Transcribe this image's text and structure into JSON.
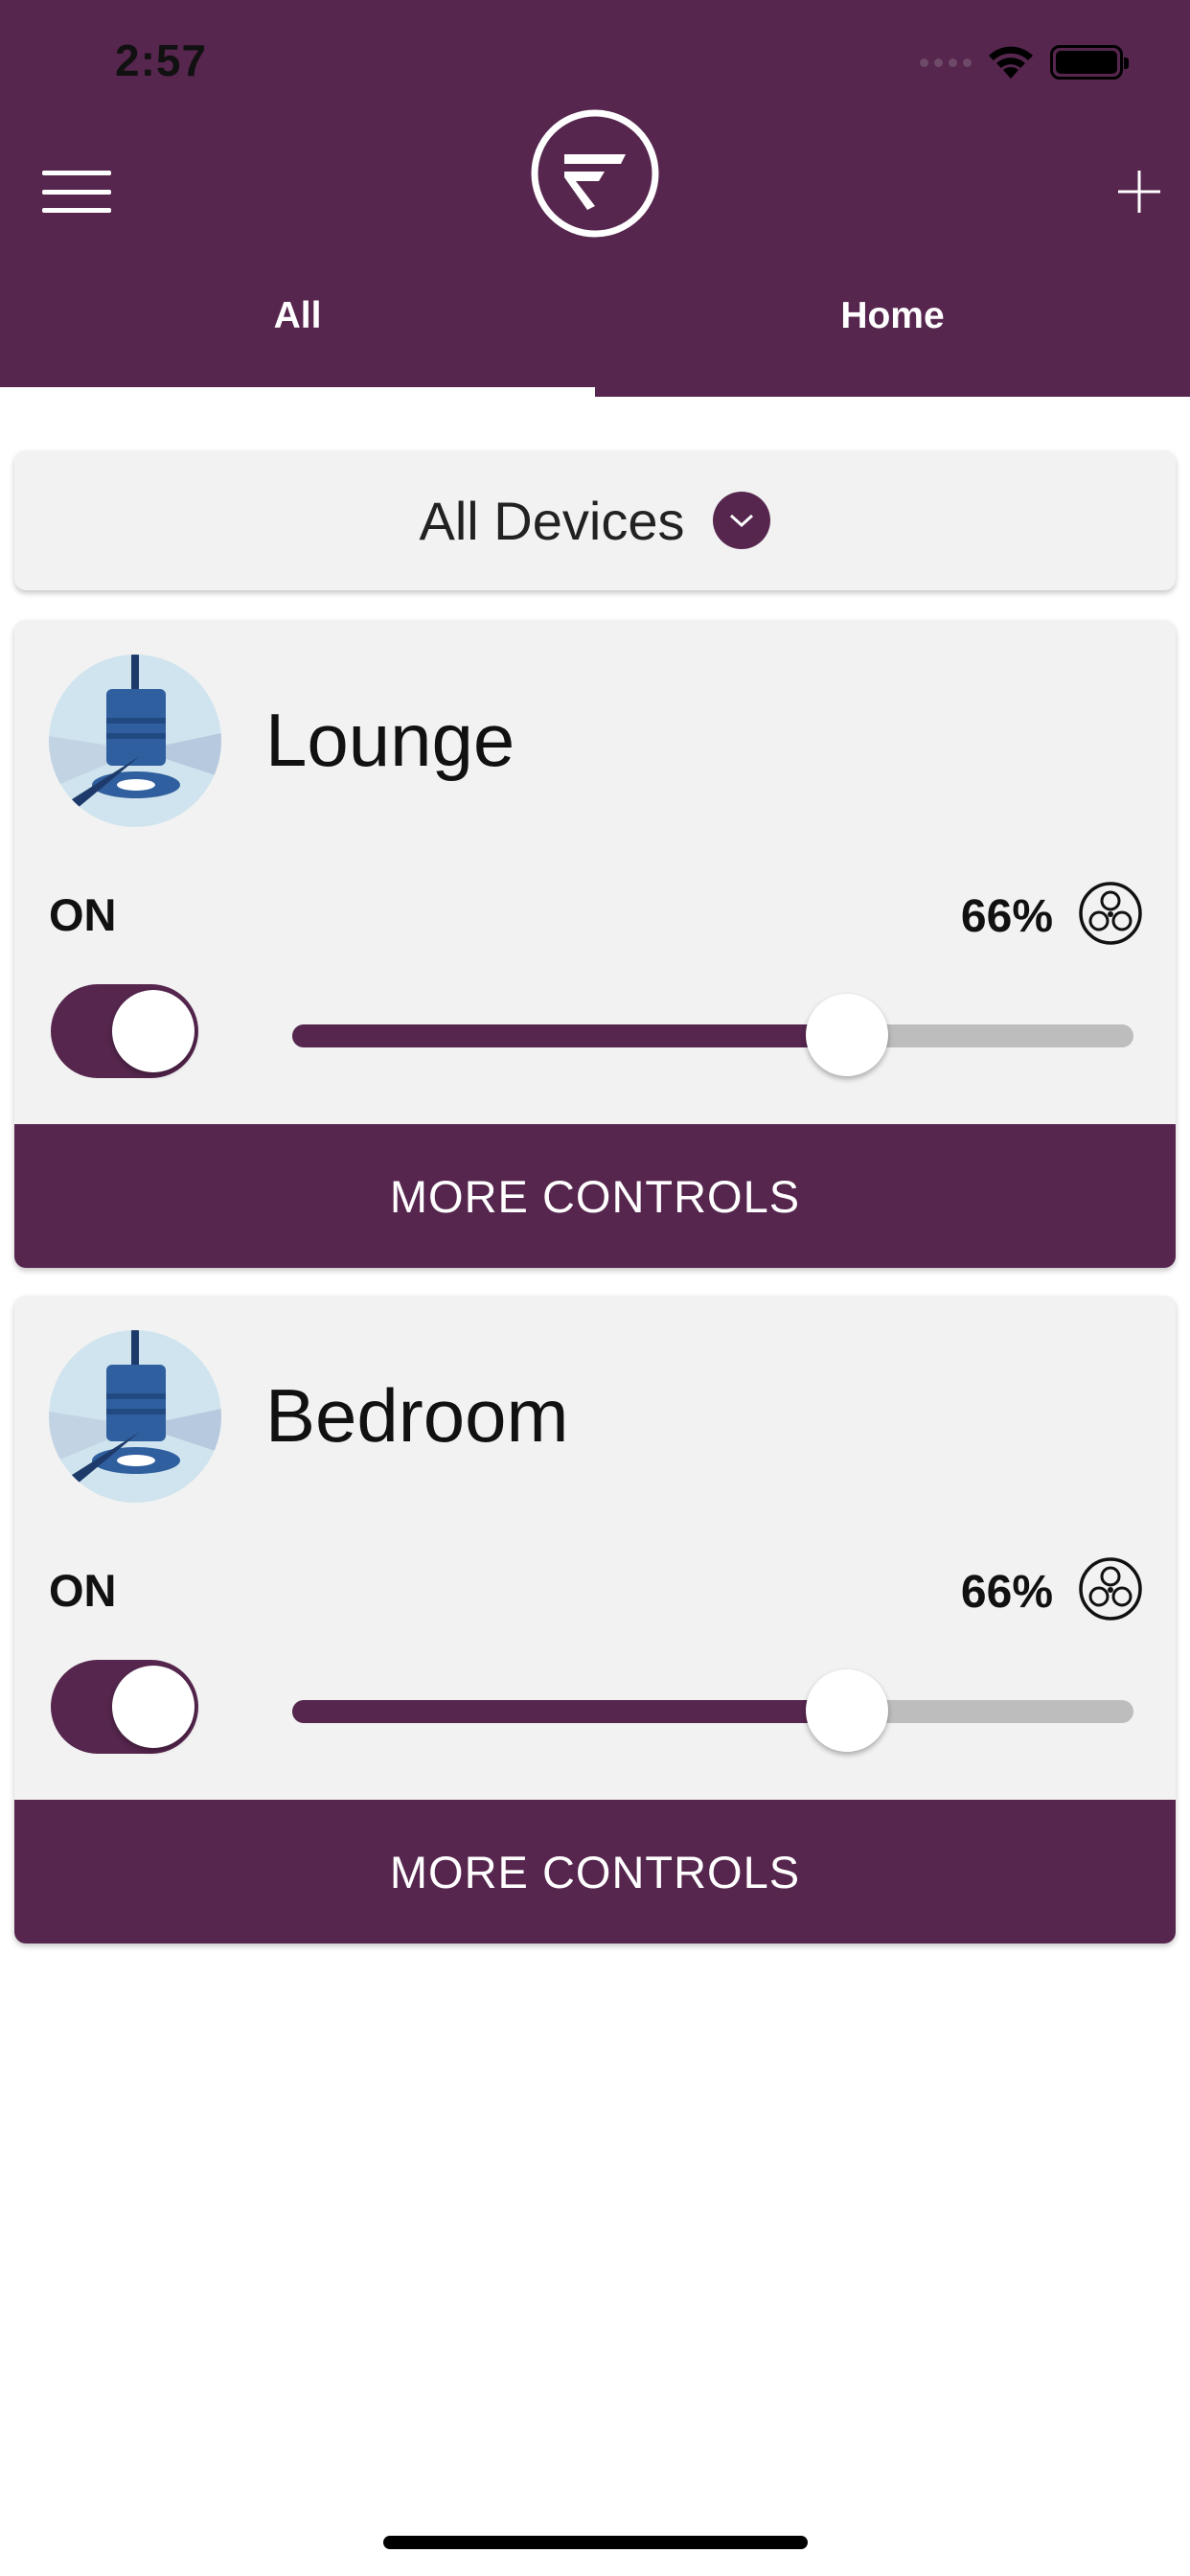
{
  "status_bar": {
    "time": "2:57"
  },
  "header": {
    "tabs": [
      {
        "label": "All",
        "active": true
      },
      {
        "label": "Home",
        "active": false
      }
    ]
  },
  "filter": {
    "label": "All Devices"
  },
  "devices": [
    {
      "name": "Lounge",
      "status": "ON",
      "speed_label": "66%",
      "speed_value": 66,
      "power_on": true,
      "more_label": "MORE CONTROLS",
      "icon": "ceiling-fan-icon"
    },
    {
      "name": "Bedroom",
      "status": "ON",
      "speed_label": "66%",
      "speed_value": 66,
      "power_on": true,
      "more_label": "MORE CONTROLS",
      "icon": "ceiling-fan-icon"
    }
  ],
  "colors": {
    "brand": "#56264e",
    "card": "#f2f2f2",
    "track": "#bdbdbd"
  }
}
